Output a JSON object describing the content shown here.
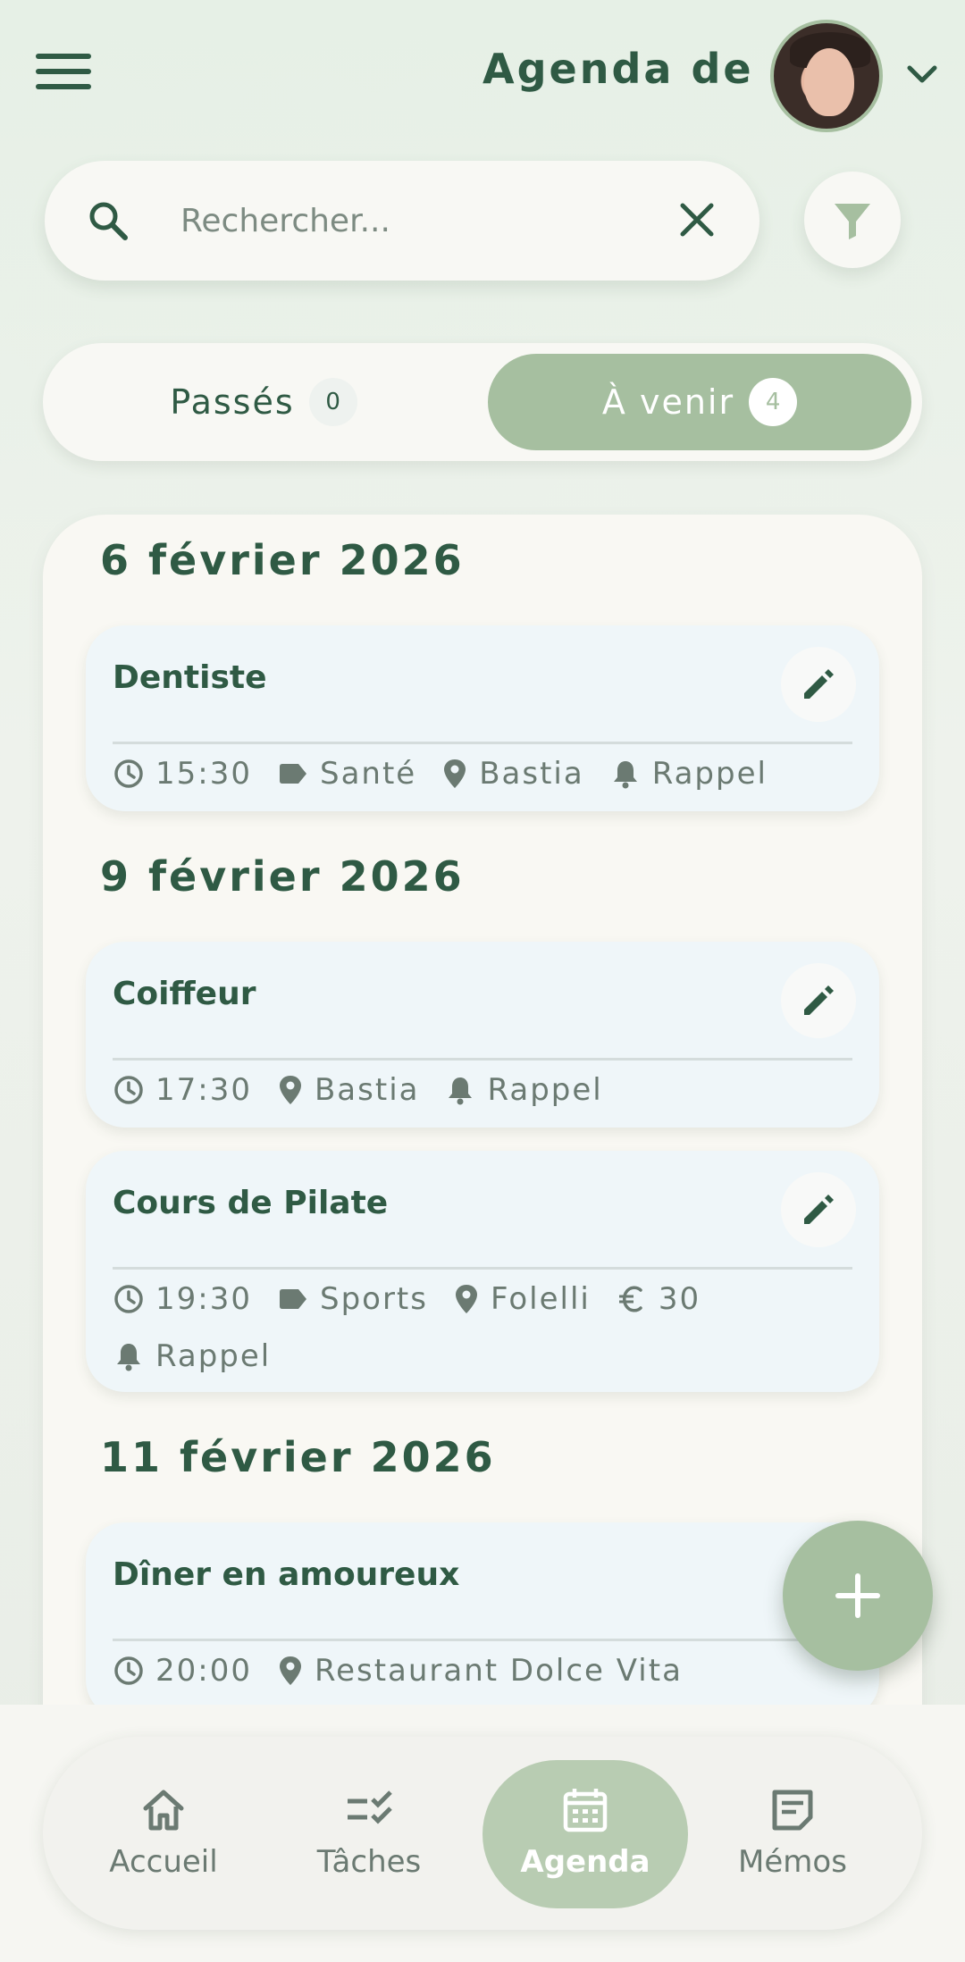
{
  "header": {
    "title": "Agenda de :",
    "menu_icon": "hamburger-icon",
    "avatar": "user-avatar",
    "dropdown_icon": "chevron-down-icon"
  },
  "search": {
    "placeholder": "Rechercher..."
  },
  "tabs": {
    "past_label": "Passés",
    "past_count": "0",
    "future_label": "À venir",
    "future_count": "4",
    "active": "future"
  },
  "groups": [
    {
      "date": "6 février 2026",
      "events": [
        {
          "title": "Dentiste",
          "time": "15:30",
          "category": "Santé",
          "location": "Bastia",
          "reminder": "Rappel"
        }
      ]
    },
    {
      "date": "9 février 2026",
      "events": [
        {
          "title": "Coiffeur",
          "time": "17:30",
          "location": "Bastia",
          "reminder": "Rappel"
        },
        {
          "title": "Cours de Pilate",
          "time": "19:30",
          "category": "Sports",
          "location": "Folelli",
          "price": "30",
          "reminder": "Rappel"
        }
      ]
    },
    {
      "date": "11 février 2026",
      "events": [
        {
          "title": "Dîner en amoureux",
          "time": "20:00",
          "location": "Restaurant Dolce Vita"
        }
      ]
    }
  ],
  "nav": {
    "home": "Accueil",
    "tasks": "Tâches",
    "agenda": "Agenda",
    "memos": "Mémos",
    "active": "agenda"
  },
  "colors": {
    "primary_dark": "#2f5a44",
    "accent_sage": "#a6bfa0",
    "card_bg": "#eff6f9",
    "muted_text": "#6b7a72"
  }
}
